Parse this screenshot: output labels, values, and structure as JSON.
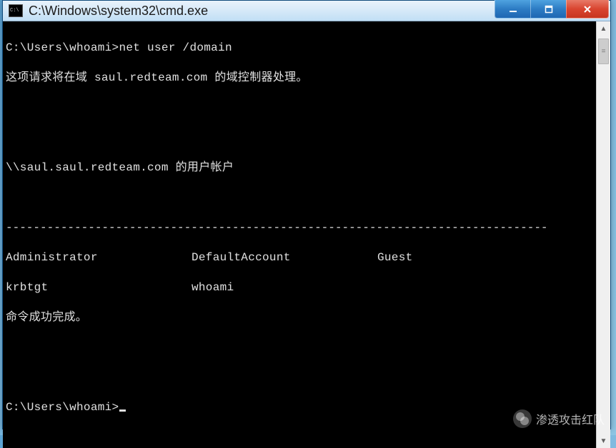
{
  "window": {
    "title": "C:\\Windows\\system32\\cmd.exe"
  },
  "terminal": {
    "prompt1": "C:\\Users\\whoami>",
    "command1": "net user /domain",
    "msg1": "这项请求将在域 saul.redteam.com 的域控制器处理。",
    "header": "\\\\saul.saul.redteam.com 的用户帐户",
    "divider": "-------------------------------------------------------------------------------",
    "row1c1": "Administrator",
    "row1c2": "DefaultAccount",
    "row1c3": "Guest",
    "row2c1": "krbtgt",
    "row2c2": "whoami",
    "row2c3": "",
    "done": "命令成功完成。",
    "prompt2": "C:\\Users\\whoami>"
  },
  "watermark": {
    "text": "渗透攻击红队"
  }
}
